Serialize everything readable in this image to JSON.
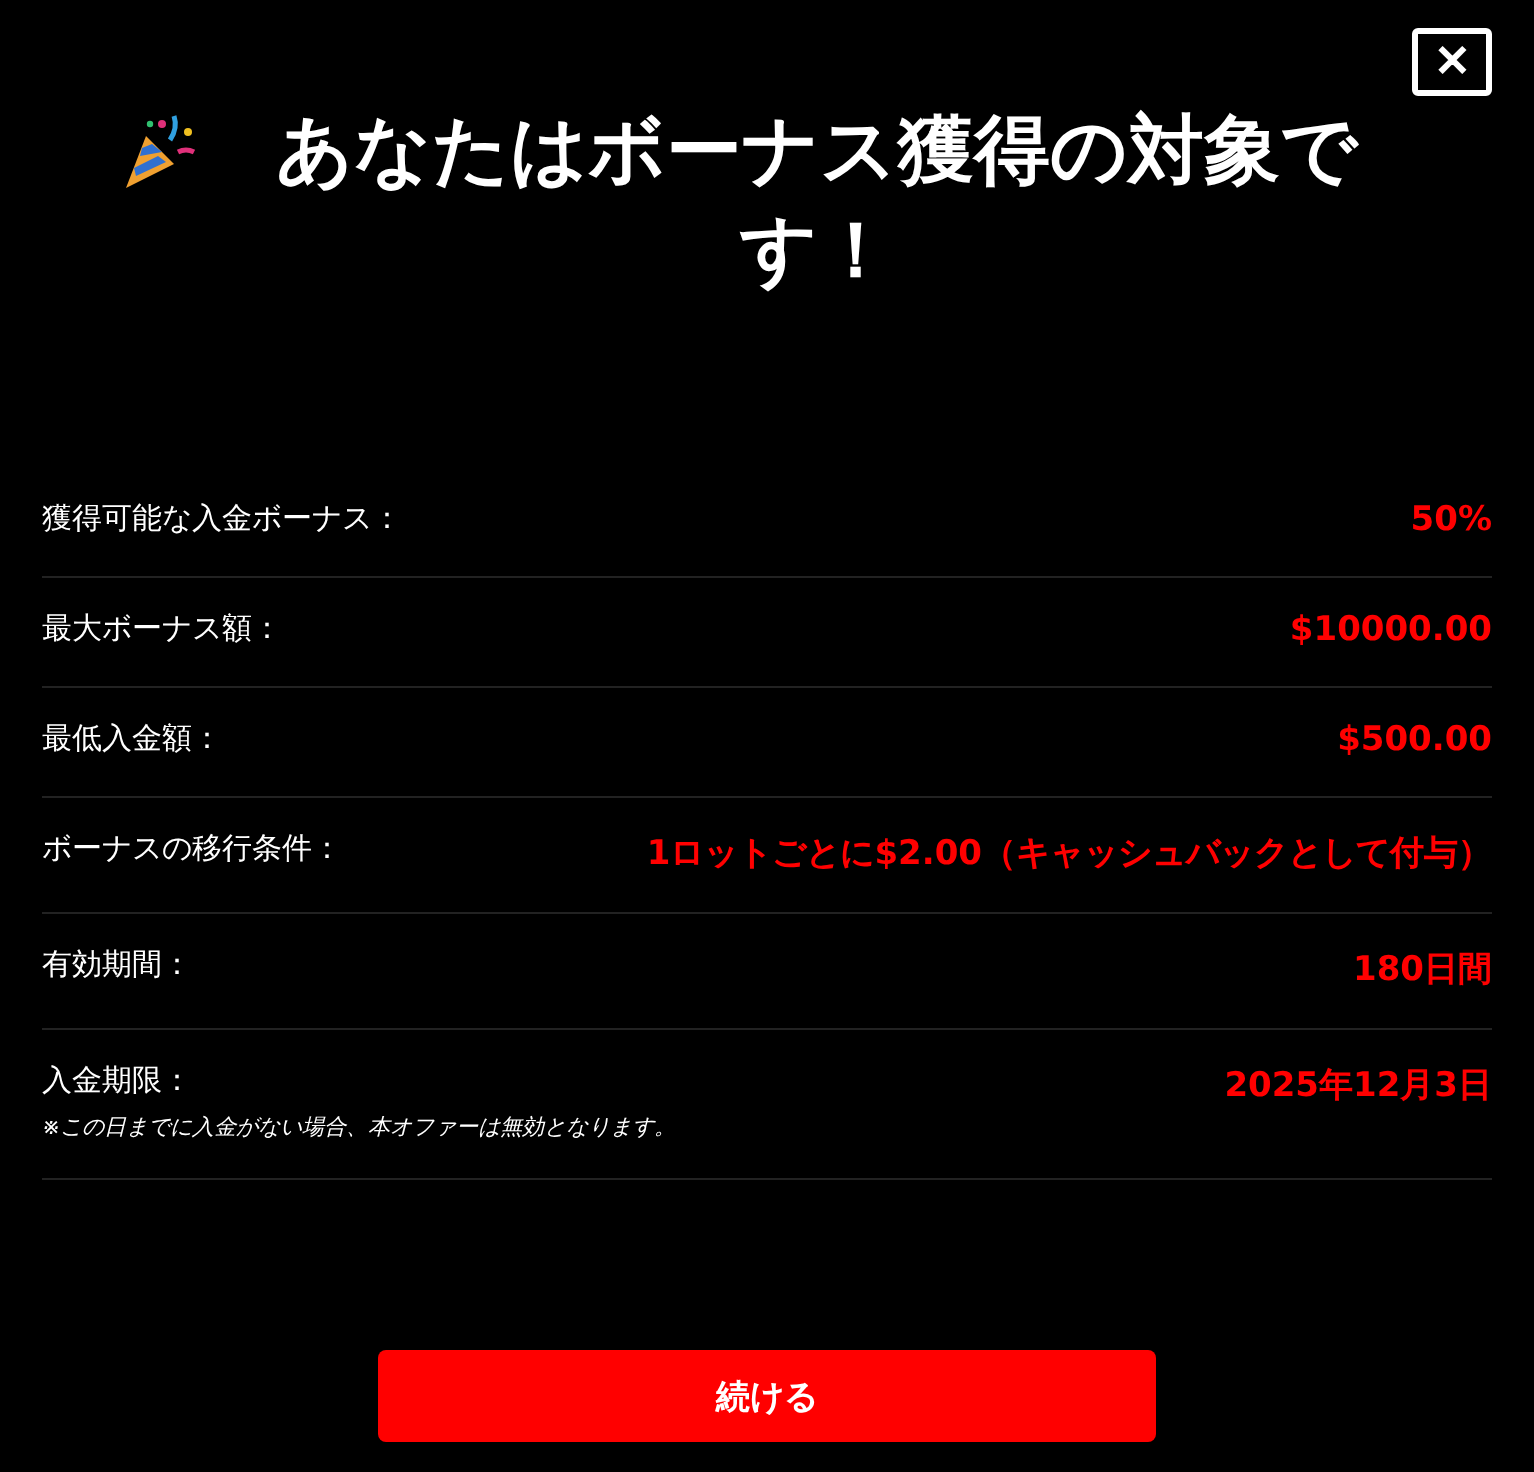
{
  "dialog": {
    "title": "あなたはボーナス獲得の対象です！",
    "close_button": {
      "label": "✕"
    },
    "rows": [
      {
        "label": "獲得可能な入金ボーナス：",
        "value": "50%"
      },
      {
        "label": "最大ボーナス額：",
        "value": "$10000.00"
      },
      {
        "label": "最低入金額：",
        "value": "$500.00"
      },
      {
        "label": "ボーナスの移行条件：",
        "value": "1ロットごとに$2.00（キャッシュバックとして付与）"
      },
      {
        "label": "有効期間：",
        "value": "180日間"
      },
      {
        "label": "入金期限：",
        "value": "2025年12月3日",
        "note": "※この日までに入金がない場合、本オファーは無効となります。"
      }
    ],
    "continue_button": {
      "label": "続ける"
    }
  }
}
